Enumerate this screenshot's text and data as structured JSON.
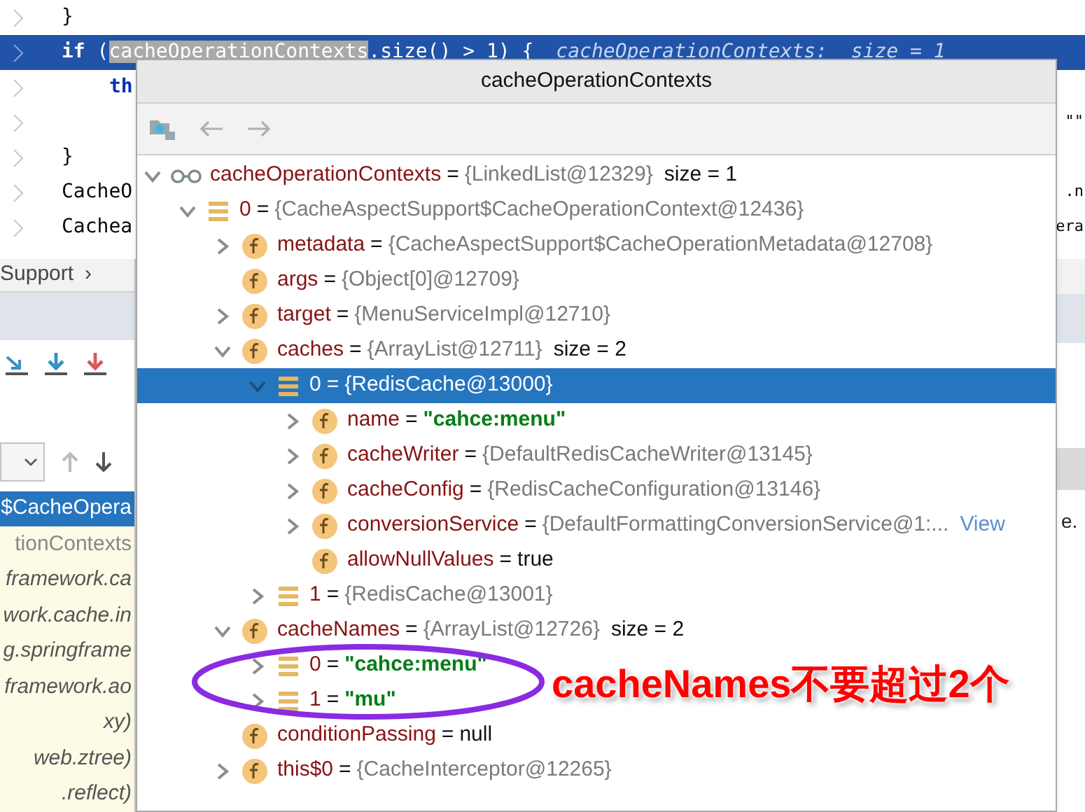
{
  "editor": {
    "lines": [
      {
        "tokens": [
          {
            "text": "}",
            "kind": "plain"
          }
        ]
      },
      {
        "selected": true,
        "tokens": [
          {
            "text": "if",
            "kind": "keyword"
          },
          {
            "text": " (",
            "kind": "plain"
          },
          {
            "text": "cacheOperationContexts",
            "kind": "highlight"
          },
          {
            "text": ".size() > 1) {",
            "kind": "plain"
          }
        ],
        "hint": "cacheOperationContexts:  size = 1",
        "children": [
          {
            "tokens": [
              {
                "text": "th",
                "kind": "keyword"
              }
            ]
          },
          {
            "right": "\"\""
          }
        ]
      },
      {
        "tokens": [
          {
            "text": "}",
            "kind": "plain"
          }
        ]
      },
      {
        "tokens": [
          {
            "text": "CacheO",
            "kind": "plain"
          }
        ],
        "right": ".n"
      },
      {
        "tokens": [
          {
            "text": "Cachea",
            "kind": "plain"
          }
        ],
        "right": "era"
      }
    ]
  },
  "debugger": {
    "breadcrumb": [
      "Support",
      "›"
    ],
    "frames": [
      {
        "text": "$CacheOpera",
        "selected": true,
        "kind": "plain"
      },
      {
        "text": "tionContexts",
        "selected": false,
        "kind": "plain"
      },
      {
        "text": "framework.ca",
        "selected": false,
        "kind": "library"
      },
      {
        "text": "work.cache.in",
        "selected": false,
        "kind": "library"
      },
      {
        "text": "g.springframe",
        "selected": false,
        "kind": "library"
      },
      {
        "text": "framework.ao",
        "selected": false,
        "kind": "library"
      },
      {
        "text": "xy)",
        "selected": false,
        "kind": "library"
      },
      {
        "text": "web.ztree)",
        "selected": false,
        "kind": "library"
      },
      {
        "text": ".reflect)",
        "selected": false,
        "kind": "library"
      }
    ],
    "right_fragment": "e."
  },
  "popup": {
    "title": "cacheOperationContexts",
    "tree": [
      {
        "kind": "watch",
        "name": "cacheOperationContexts",
        "sep": "=",
        "object": "{LinkedList@12329}",
        "extra": "size = 1",
        "expanded": true,
        "selected": false,
        "children": [
          {
            "kind": "element",
            "name": "0",
            "sep": "=",
            "object": "{CacheAspectSupport$CacheOperationContext@12436}",
            "expanded": true,
            "selected": false,
            "children": [
              {
                "kind": "field",
                "name": "metadata",
                "sep": "=",
                "object": "{CacheAspectSupport$CacheOperationMetadata@12708}",
                "expanded": false,
                "selected": false
              },
              {
                "kind": "field",
                "name": "args",
                "sep": "=",
                "object": "{Object[0]@12709}",
                "selected": false
              },
              {
                "kind": "field",
                "name": "target",
                "sep": "=",
                "object": "{MenuServiceImpl@12710}",
                "expanded": false,
                "selected": false
              },
              {
                "kind": "field",
                "name": "caches",
                "sep": "=",
                "object": "{ArrayList@12711}",
                "extra": "size = 2",
                "expanded": true,
                "selected": false,
                "children": [
                  {
                    "kind": "element",
                    "name": "0",
                    "sep": "=",
                    "object": "{RedisCache@13000}",
                    "expanded": true,
                    "selected": true,
                    "children": [
                      {
                        "kind": "field",
                        "name": "name",
                        "sep": "=",
                        "string": "\"cahce:menu\"",
                        "expanded": false,
                        "selected": false
                      },
                      {
                        "kind": "field",
                        "name": "cacheWriter",
                        "sep": "=",
                        "object": "{DefaultRedisCacheWriter@13145}",
                        "expanded": false,
                        "selected": false
                      },
                      {
                        "kind": "field",
                        "name": "cacheConfig",
                        "sep": "=",
                        "object": "{RedisCacheConfiguration@13146}",
                        "expanded": false,
                        "selected": false
                      },
                      {
                        "kind": "field",
                        "name": "conversionService",
                        "sep": "=",
                        "object": "{DefaultFormattingConversionService@1:...",
                        "link": "View",
                        "expanded": false,
                        "selected": false
                      },
                      {
                        "kind": "field",
                        "name": "allowNullValues",
                        "sep": "=",
                        "literal": "true",
                        "selected": false
                      }
                    ]
                  },
                  {
                    "kind": "element",
                    "name": "1",
                    "sep": "=",
                    "object": "{RedisCache@13001}",
                    "expanded": false,
                    "selected": false
                  }
                ]
              },
              {
                "kind": "field",
                "name": "cacheNames",
                "sep": "=",
                "object": "{ArrayList@12726}",
                "extra": "size = 2",
                "expanded": true,
                "selected": false,
                "children": [
                  {
                    "kind": "element",
                    "name": "0",
                    "sep": "=",
                    "string": "\"cahce:menu\"",
                    "expanded": false,
                    "selected": false
                  },
                  {
                    "kind": "element",
                    "name": "1",
                    "sep": "=",
                    "string": "\"mu\"",
                    "expanded": false,
                    "selected": false
                  }
                ]
              },
              {
                "kind": "field",
                "name": "conditionPassing",
                "sep": "=",
                "literal": "null",
                "selected": false
              },
              {
                "kind": "field",
                "name": "this$0",
                "sep": "=",
                "object": "{CacheInterceptor@12265}",
                "expanded": false,
                "selected": false
              }
            ]
          }
        ]
      }
    ]
  },
  "annotation": {
    "text": "cacheNames不要超过2个"
  }
}
